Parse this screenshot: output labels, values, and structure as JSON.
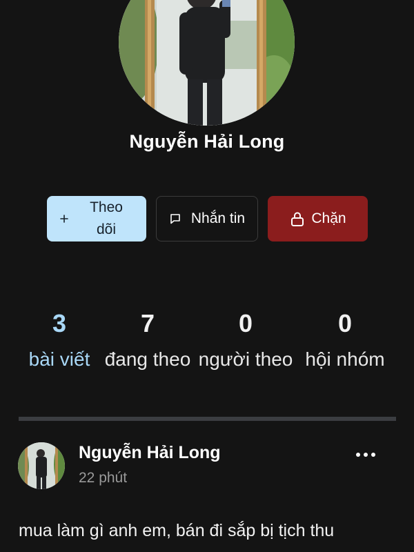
{
  "profile": {
    "name": "Nguyễn Hải Long"
  },
  "actions": {
    "follow_label": "Theo dõi",
    "message_label": "Nhắn tin",
    "block_label": "Chặn"
  },
  "stats": [
    {
      "count": "3",
      "label": "bài viết",
      "active": true
    },
    {
      "count": "7",
      "label": "đang theo",
      "active": false
    },
    {
      "count": "0",
      "label": "người theo",
      "active": false
    },
    {
      "count": "0",
      "label": "hội nhóm",
      "active": false
    }
  ],
  "post": {
    "author": "Nguyễn Hải Long",
    "time": "22 phút",
    "text": "mua làm gì anh em, bán đi sắp bị tịch thu"
  },
  "colors": {
    "background": "#141414",
    "follow_button": "#bfe4fb",
    "block_button": "#8b1d1d",
    "active_stat": "#a9d8f7",
    "divider": "#3b3d41"
  },
  "icons": {
    "follow": "plus-icon",
    "message": "chat-bubble-icon",
    "block": "lock-icon",
    "post_menu": "more-horizontal-icon"
  }
}
